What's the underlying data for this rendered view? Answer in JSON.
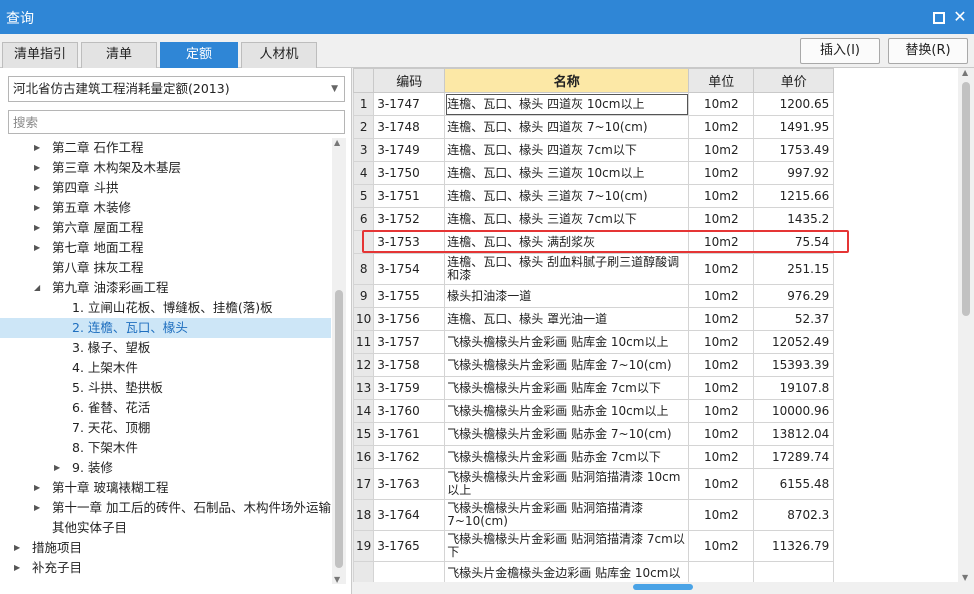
{
  "window": {
    "title": "查询",
    "close_glyph": "✕"
  },
  "tabs": [
    {
      "label": "清单指引",
      "active": false
    },
    {
      "label": "清单",
      "active": false
    },
    {
      "label": "定额",
      "active": true
    },
    {
      "label": "人材机",
      "active": false
    }
  ],
  "buttons": {
    "insert": "插入(I)",
    "replace": "替换(R)"
  },
  "left": {
    "library": "河北省仿古建筑工程消耗量定额(2013)",
    "search_placeholder": "搜索",
    "tree": [
      {
        "label": "第二章 石作工程",
        "arrow": "▶",
        "level": 1
      },
      {
        "label": "第三章 木构架及木基层",
        "arrow": "▶",
        "level": 1
      },
      {
        "label": "第四章 斗拱",
        "arrow": "▶",
        "level": 1
      },
      {
        "label": "第五章 木装修",
        "arrow": "▶",
        "level": 1
      },
      {
        "label": "第六章 屋面工程",
        "arrow": "▶",
        "level": 1
      },
      {
        "label": "第七章 地面工程",
        "arrow": "▶",
        "level": 1
      },
      {
        "label": "第八章 抹灰工程",
        "arrow": "",
        "level": 1
      },
      {
        "label": "第九章 油漆彩画工程",
        "arrow": "◢",
        "level": 1
      },
      {
        "label": "1. 立闸山花板、博缝板、挂檐(落)板",
        "arrow": "",
        "level": 2
      },
      {
        "label": "2. 连檐、瓦口、椽头",
        "arrow": "",
        "level": 2,
        "selected": true
      },
      {
        "label": "3. 椽子、望板",
        "arrow": "",
        "level": 2
      },
      {
        "label": "4. 上架木件",
        "arrow": "",
        "level": 2
      },
      {
        "label": "5. 斗拱、垫拱板",
        "arrow": "",
        "level": 2
      },
      {
        "label": "6. 雀替、花活",
        "arrow": "",
        "level": 2
      },
      {
        "label": "7. 天花、顶棚",
        "arrow": "",
        "level": 2
      },
      {
        "label": "8. 下架木件",
        "arrow": "",
        "level": 2
      },
      {
        "label": "9. 装修",
        "arrow": "▶",
        "level": 2
      },
      {
        "label": "第十章 玻璃裱糊工程",
        "arrow": "▶",
        "level": 1
      },
      {
        "label": "第十一章 加工后的砖件、石制品、木构件场外运输",
        "arrow": "▶",
        "level": 1
      },
      {
        "label": "其他实体子目",
        "arrow": "",
        "level": 1
      },
      {
        "label": "措施项目",
        "arrow": "▶",
        "level": 0
      },
      {
        "label": "补充子目",
        "arrow": "▶",
        "level": 0
      }
    ]
  },
  "grid": {
    "headers": {
      "code": "编码",
      "name": "名称",
      "unit": "单位",
      "price": "单价"
    },
    "rows": [
      {
        "num": "1",
        "code": "3-1747",
        "name": "连檐、瓦口、椽头 四道灰 10cm以上",
        "unit": "10m2",
        "price": "1200.65"
      },
      {
        "num": "2",
        "code": "3-1748",
        "name": "连檐、瓦口、椽头 四道灰 7~10(cm)",
        "unit": "10m2",
        "price": "1491.95"
      },
      {
        "num": "3",
        "code": "3-1749",
        "name": "连檐、瓦口、椽头 四道灰 7cm以下",
        "unit": "10m2",
        "price": "1753.49"
      },
      {
        "num": "4",
        "code": "3-1750",
        "name": "连檐、瓦口、椽头 三道灰 10cm以上",
        "unit": "10m2",
        "price": "997.92"
      },
      {
        "num": "5",
        "code": "3-1751",
        "name": "连檐、瓦口、椽头 三道灰 7~10(cm)",
        "unit": "10m2",
        "price": "1215.66"
      },
      {
        "num": "6",
        "code": "3-1752",
        "name": "连檐、瓦口、椽头 三道灰 7cm以下",
        "unit": "10m2",
        "price": "1435.2"
      },
      {
        "num": "",
        "code": "3-1753",
        "name": "连檐、瓦口、椽头 满刮浆灰",
        "unit": "10m2",
        "price": "75.54"
      },
      {
        "num": "8",
        "code": "3-1754",
        "name": "连檐、瓦口、椽头 刮血料腻子刷三道醇酸调和漆",
        "unit": "10m2",
        "price": "251.15",
        "tall": true
      },
      {
        "num": "9",
        "code": "3-1755",
        "name": "椽头扣油漆一道",
        "unit": "10m2",
        "price": "976.29"
      },
      {
        "num": "10",
        "code": "3-1756",
        "name": "连檐、瓦口、椽头 罩光油一道",
        "unit": "10m2",
        "price": "52.37"
      },
      {
        "num": "11",
        "code": "3-1757",
        "name": "飞椽头檐椽头片金彩画 贴库金 10cm以上",
        "unit": "10m2",
        "price": "12052.49"
      },
      {
        "num": "12",
        "code": "3-1758",
        "name": "飞椽头檐椽头片金彩画 贴库金 7~10(cm)",
        "unit": "10m2",
        "price": "15393.39"
      },
      {
        "num": "13",
        "code": "3-1759",
        "name": "飞椽头檐椽头片金彩画 贴库金 7cm以下",
        "unit": "10m2",
        "price": "19107.8"
      },
      {
        "num": "14",
        "code": "3-1760",
        "name": "飞椽头檐椽头片金彩画 贴赤金 10cm以上",
        "unit": "10m2",
        "price": "10000.96"
      },
      {
        "num": "15",
        "code": "3-1761",
        "name": "飞椽头檐椽头片金彩画 贴赤金 7~10(cm)",
        "unit": "10m2",
        "price": "13812.04"
      },
      {
        "num": "16",
        "code": "3-1762",
        "name": "飞椽头檐椽头片金彩画 贴赤金 7cm以下",
        "unit": "10m2",
        "price": "17289.74"
      },
      {
        "num": "17",
        "code": "3-1763",
        "name": "飞椽头檐椽头片金彩画 贴洞箔描清漆 10cm以上",
        "unit": "10m2",
        "price": "6155.48",
        "tall": true
      },
      {
        "num": "18",
        "code": "3-1764",
        "name": "飞椽头檐椽头片金彩画 贴洞箔描清漆 7~10(cm)",
        "unit": "10m2",
        "price": "8702.3",
        "tall": true
      },
      {
        "num": "19",
        "code": "3-1765",
        "name": "飞椽头檐椽头片金彩画 贴洞箔描清漆 7cm以下",
        "unit": "10m2",
        "price": "11326.79",
        "tall": true
      },
      {
        "num": "",
        "code": "",
        "name": "飞椽头片金檐椽头金边彩画 贴库金 10cm以",
        "unit": "",
        "price": ""
      }
    ]
  },
  "colors": {
    "accent": "#2f86d6",
    "header_highlight": "#fce8a6",
    "selection_box": "#e53535",
    "tree_selected": "#cde6f7"
  },
  "icons": {
    "maximize": "maximize-icon",
    "close": "close-icon",
    "dropdown": "chevron-down-icon",
    "collapsed": "triangle-right-icon",
    "expanded": "triangle-down-icon"
  }
}
